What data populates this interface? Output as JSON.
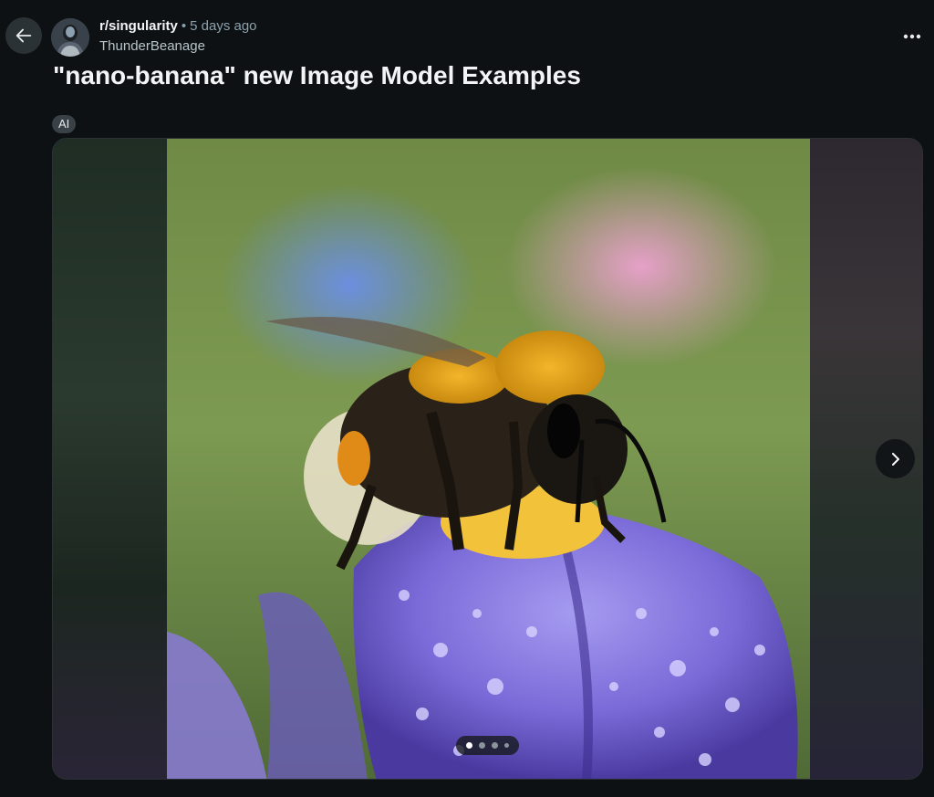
{
  "post": {
    "subreddit": "r/singularity",
    "separator": "•",
    "time_ago": "5 days ago",
    "author": "ThunderBeanage",
    "title": "\"nano-banana\" new Image Model Examples",
    "flair": "AI",
    "body_preview": ""
  },
  "gallery": {
    "total_images": 4,
    "current_index": 1,
    "image_description_icon": "bee-on-iris-photo"
  },
  "icons": {
    "back": "arrow-left-icon",
    "more": "more-horizontal-icon",
    "next": "chevron-right-icon"
  },
  "colors": {
    "background": "#0e1113",
    "flair_bg": "#3a4146",
    "button_bg": "#2a3236"
  }
}
